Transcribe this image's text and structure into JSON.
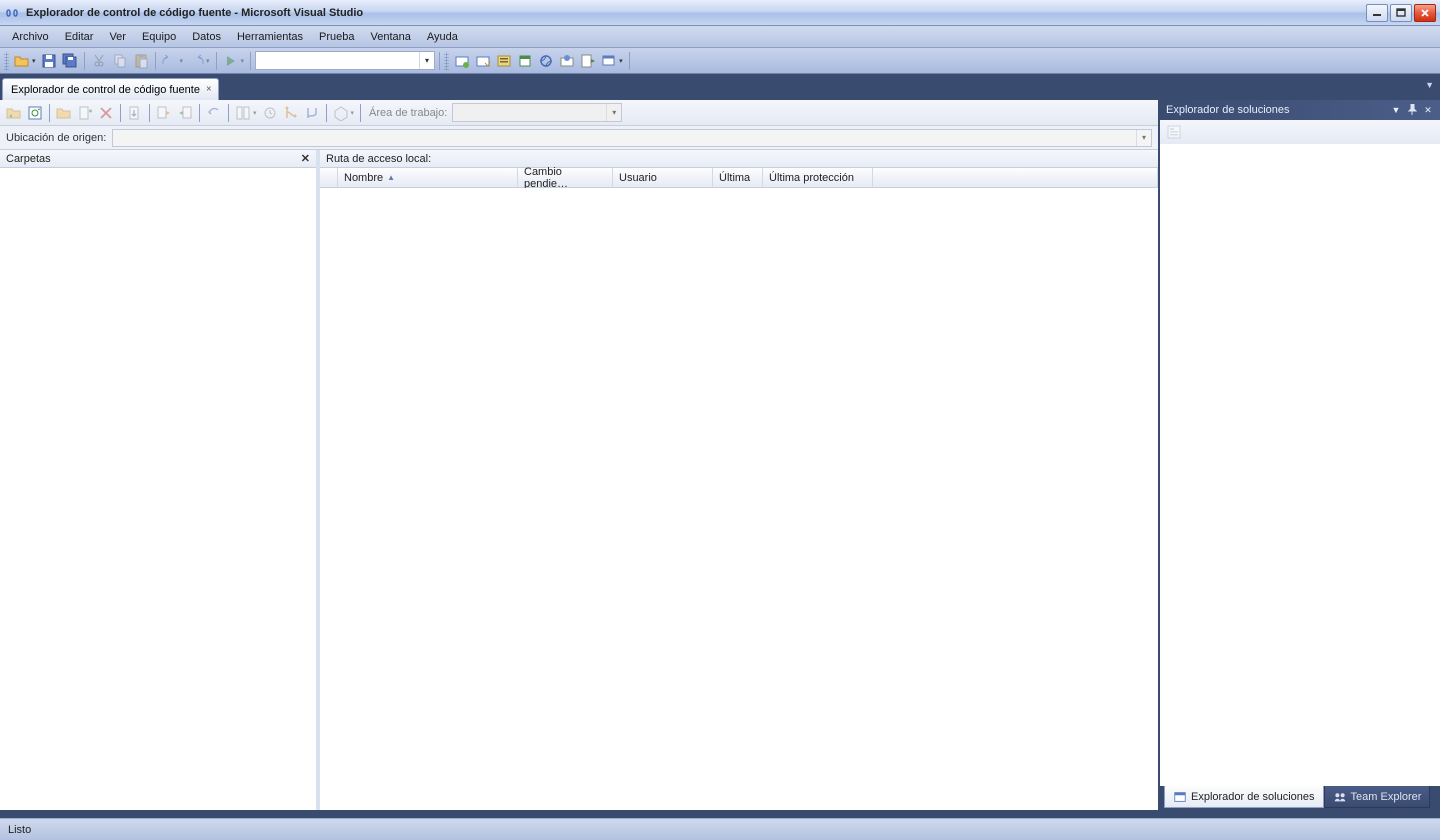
{
  "window": {
    "title": "Explorador de control de código fuente - Microsoft Visual Studio"
  },
  "menu": {
    "items": [
      "Archivo",
      "Editar",
      "Ver",
      "Equipo",
      "Datos",
      "Herramientas",
      "Prueba",
      "Ventana",
      "Ayuda"
    ]
  },
  "doctab": {
    "label": "Explorador de control de código fuente"
  },
  "src": {
    "workspace_label": "Área de trabajo:",
    "origin_label": "Ubicación de origen:",
    "folders_label": "Carpetas",
    "localpath_label": "Ruta de acceso local:",
    "columns": {
      "nombre": "Nombre",
      "cambio": "Cambio pendie…",
      "usuario": "Usuario",
      "ultima": "Última",
      "ultima_prot": "Última protección"
    }
  },
  "solution": {
    "title": "Explorador de soluciones",
    "tabs": {
      "solution": "Explorador de soluciones",
      "team": "Team Explorer"
    }
  },
  "status": {
    "text": "Listo"
  }
}
